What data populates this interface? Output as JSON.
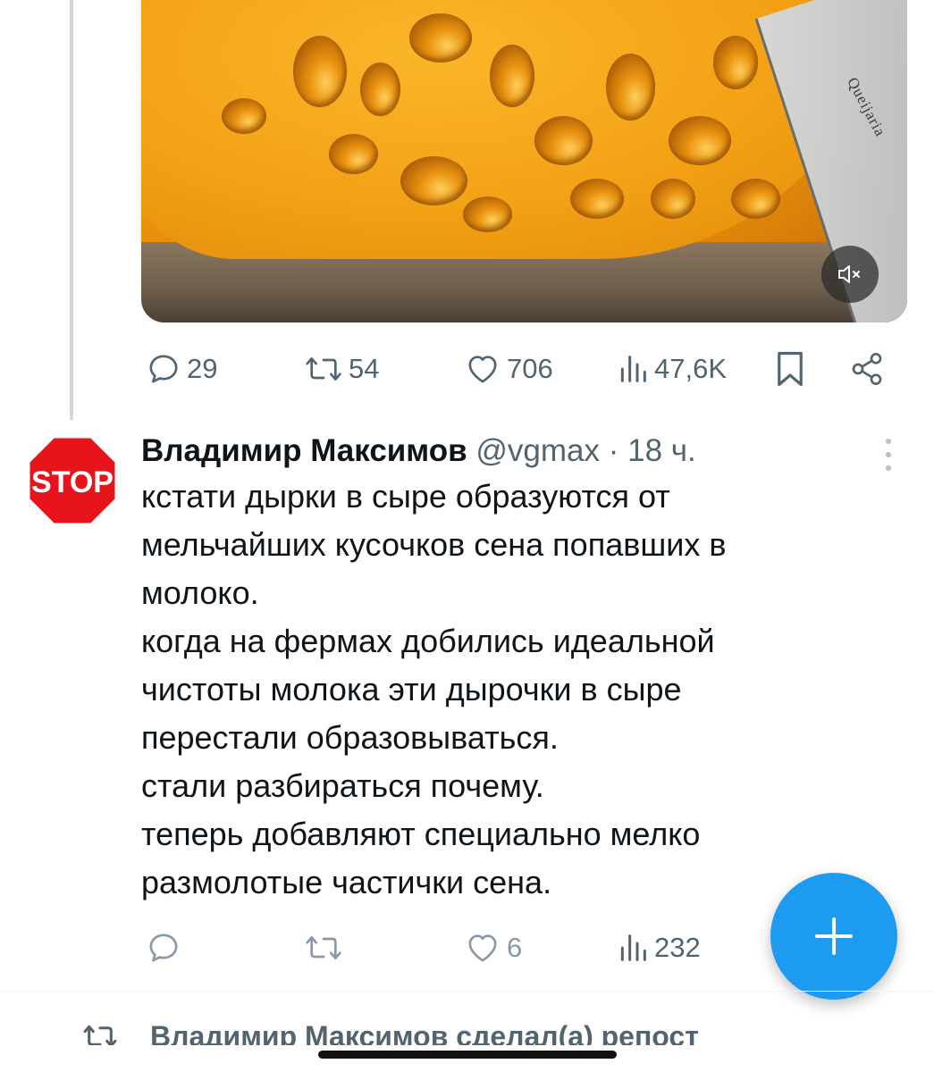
{
  "media": {
    "knife_brand_text": "Queijaria",
    "mute_icon": "volume-muted-icon"
  },
  "parent_tweet": {
    "actions": {
      "replies": "29",
      "reposts": "54",
      "likes": "706",
      "views": "47,6K"
    }
  },
  "tweet": {
    "avatar_text": "STOP",
    "author_name": "Владимир Максимов",
    "handle": "@vgmax",
    "separator": " · ",
    "time": "18 ч.",
    "text": "кстати дырки в сыре образуются от\nмельчайших кусочков сена попавших в\nмолоко.\nкогда на фермах добились идеальной\nчистоты молока эти дырочки в сыре\nперестали образовываться.\nстали разбираться почему.\nтеперь добавляют специально мелко\nразмолотые частички сена.",
    "actions": {
      "replies": "",
      "reposts": "",
      "likes": "6",
      "views": "232"
    }
  },
  "next_item": {
    "repost_label": "Владимир Максимов сделал(а) репост"
  },
  "colors": {
    "accent": "#1d9bf0",
    "muted": "#536471",
    "stop_red": "#e8141b"
  }
}
